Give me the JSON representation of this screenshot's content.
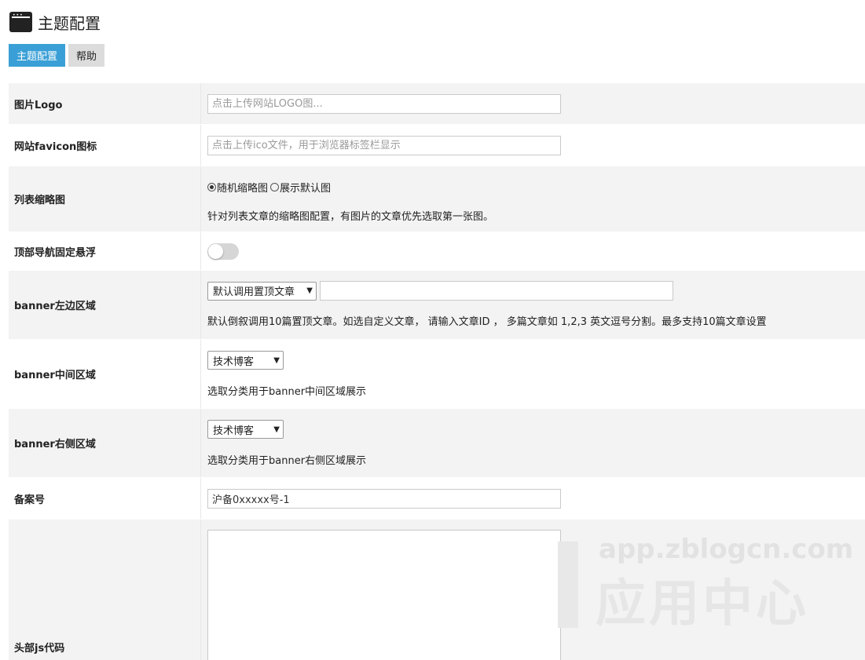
{
  "header": {
    "title": "主题配置",
    "icon": "browser-window-icon"
  },
  "tabs": [
    {
      "label": "主题配置",
      "active": true
    },
    {
      "label": "帮助",
      "active": false
    }
  ],
  "colors": {
    "accent": "#3a9fd6",
    "row_gray": "#f3f3f3"
  },
  "form": {
    "logo": {
      "label": "图片Logo",
      "placeholder": "点击上传网站LOGO图..."
    },
    "favicon": {
      "label": "网站favicon图标",
      "placeholder": "点击上传ico文件，用于浏览器标签栏显示"
    },
    "thumbnail": {
      "label": "列表缩略图",
      "options": [
        "随机缩略图",
        "展示默认图"
      ],
      "selected": "随机缩略图",
      "hint": "针对列表文章的缩略图配置，有图片的文章优先选取第一张图。"
    },
    "fixed_nav": {
      "label": "顶部导航固定悬浮",
      "enabled": false
    },
    "banner_left": {
      "label": "banner左边区域",
      "select_value": "默认调用置顶文章",
      "input_value": "",
      "hint": "默认倒叙调用10篇置顶文章。如选自定义文章， 请输入文章ID ， 多篇文章如 1,2,3 英文逗号分割。最多支持10篇文章设置"
    },
    "banner_middle": {
      "label": "banner中间区域",
      "select_value": "技术博客",
      "hint": "选取分类用于banner中间区域展示"
    },
    "banner_right": {
      "label": "banner右侧区域",
      "select_value": "技术博客",
      "hint": "选取分类用于banner右侧区域展示"
    },
    "icp": {
      "label": "备案号",
      "value": "沪备0xxxxx号-1"
    },
    "head_js": {
      "label": "头部js代码",
      "value": ""
    }
  },
  "watermark": {
    "url": "app.zblogcn.com",
    "text": "应用中心"
  }
}
